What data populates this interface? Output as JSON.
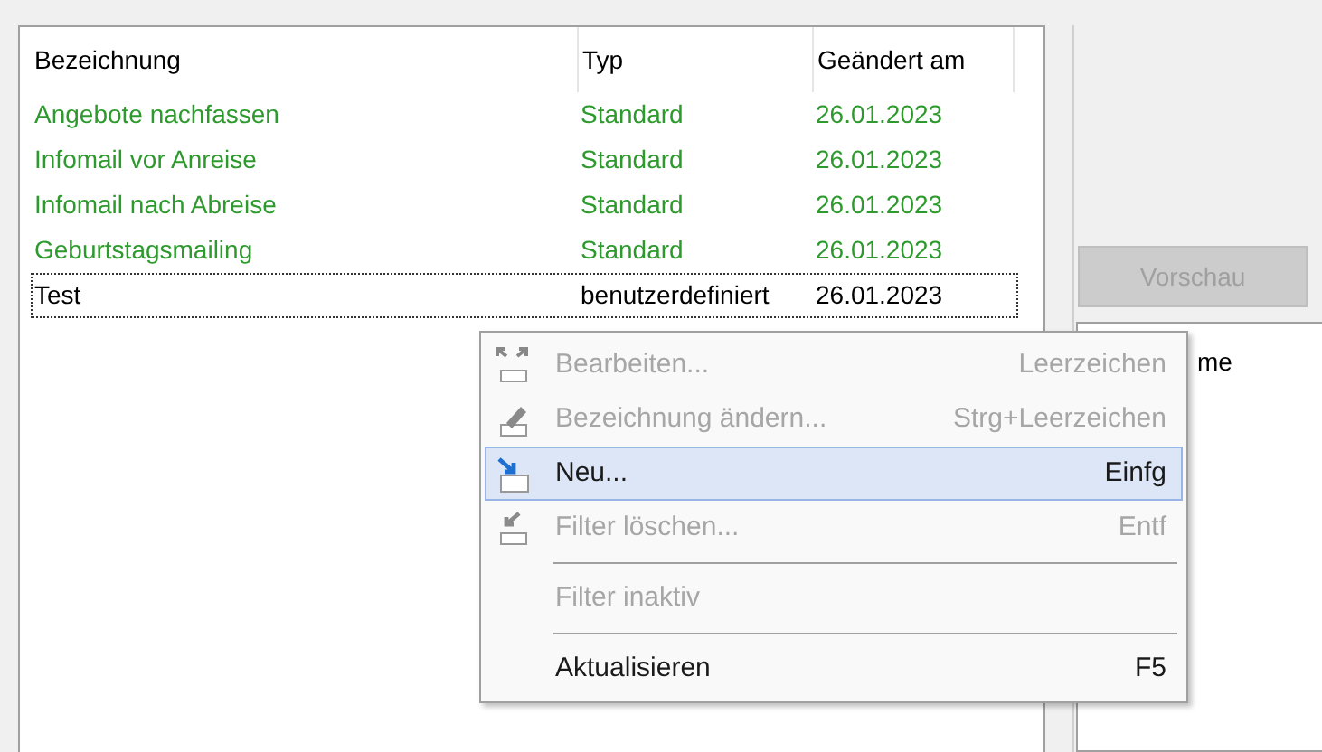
{
  "list": {
    "columns": [
      "Bezeichnung",
      "Typ",
      "Geändert am"
    ],
    "rows": [
      {
        "cells": [
          "Angebote nachfassen",
          "Standard",
          "26.01.2023"
        ],
        "kind": "standard",
        "focused": false
      },
      {
        "cells": [
          "Infomail vor Anreise",
          "Standard",
          "26.01.2023"
        ],
        "kind": "standard",
        "focused": false
      },
      {
        "cells": [
          "Infomail nach Abreise",
          "Standard",
          "26.01.2023"
        ],
        "kind": "standard",
        "focused": false
      },
      {
        "cells": [
          "Geburtstagsmailing",
          "Standard",
          "26.01.2023"
        ],
        "kind": "standard",
        "focused": false
      },
      {
        "cells": [
          "Test",
          "benutzerdefiniert",
          "26.01.2023"
        ],
        "kind": "custom",
        "focused": true
      }
    ]
  },
  "preview_button": {
    "label": "Vorschau",
    "disabled": true
  },
  "side_panel": {
    "text": "me"
  },
  "context_menu": {
    "items": [
      {
        "kind": "item",
        "label": "Bearbeiten...",
        "shortcut": "Leerzeichen",
        "disabled": true,
        "selected": false
      },
      {
        "kind": "item",
        "label": "Bezeichnung ändern...",
        "shortcut": "Strg+Leerzeichen",
        "disabled": true,
        "selected": false
      },
      {
        "kind": "item",
        "label": "Neu...",
        "shortcut": "Einfg",
        "disabled": false,
        "selected": true
      },
      {
        "kind": "item",
        "label": "Filter löschen...",
        "shortcut": "Entf",
        "disabled": true,
        "selected": false
      },
      {
        "kind": "separator"
      },
      {
        "kind": "item",
        "label": "Filter inaktiv",
        "disabled": true,
        "selected": false
      },
      {
        "kind": "separator"
      },
      {
        "kind": "item",
        "label": "Aktualisieren",
        "shortcut": "F5",
        "disabled": false,
        "selected": false
      }
    ]
  }
}
